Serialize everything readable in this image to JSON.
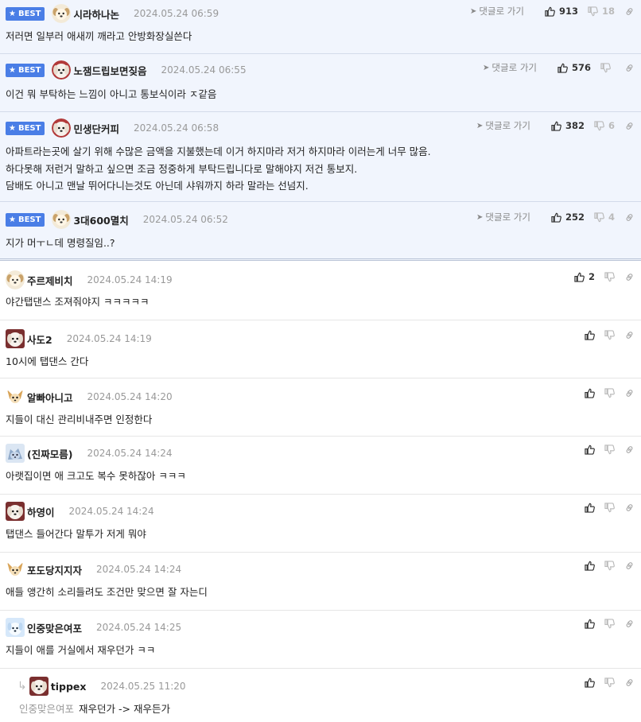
{
  "best_comments": [
    {
      "badge": "BEST",
      "nick": "시라하나논",
      "date": "2024.05.24 06:59",
      "goto": "댓글로 가기",
      "likes": "913",
      "dislikes": "18",
      "avatar": "dog-pup",
      "lines": [
        "저러면 일부러 애새끼 깨라고 안방화장실쓴다"
      ]
    },
    {
      "badge": "BEST",
      "nick": "노잼드립보면짖음",
      "date": "2024.05.24 06:55",
      "goto": "댓글로 가기",
      "likes": "576",
      "dislikes": "",
      "avatar": "dog-maltese",
      "lines": [
        "이건 뭐 부탁하는 느낌이 아니고 통보식이라 ㅈ같음"
      ]
    },
    {
      "badge": "BEST",
      "nick": "민생단커피",
      "date": "2024.05.24 06:58",
      "goto": "댓글로 가기",
      "likes": "382",
      "dislikes": "6",
      "avatar": "dog-maltese",
      "lines": [
        "아파트라는곳에 살기 위해 수많은 금액을 지불했는데 이거 하지마라 저거 하지마라 이러는게 너무 많음.",
        "하다못해 저런거 말하고 싶으면 조금 정중하게 부탁드립니다로 말해야지 저건 통보지.",
        "담배도 아니고 맨날 뛰어다니는것도 아닌데 샤워까지 하라 말라는 선넘지."
      ]
    },
    {
      "badge": "BEST",
      "nick": "3대600멸치",
      "date": "2024.05.24 06:52",
      "goto": "댓글로 가기",
      "likes": "252",
      "dislikes": "4",
      "avatar": "dog-pup",
      "lines": [
        "지가 머ㅜㄴ데 명령질임..?"
      ]
    }
  ],
  "comments": [
    {
      "nick": "주르제비치",
      "date": "2024.05.24 14:19",
      "likes": "2",
      "avatar": "dog-pup",
      "text": "야간탭댄스 조져줘야지 ㅋㅋㅋㅋㅋ"
    },
    {
      "nick": "사도2",
      "date": "2024.05.24 14:19",
      "likes": "",
      "avatar": "dog-maltese-sq",
      "text": "10시에 탭댄스 간다"
    },
    {
      "nick": "알빠아니고",
      "date": "2024.05.24 14:20",
      "likes": "",
      "avatar": "chihuahua",
      "text": "지들이 대신 관리비내주면 인정한다"
    },
    {
      "nick": "(진짜모름)",
      "date": "2024.05.24 14:24",
      "likes": "",
      "avatar": "blue-dog",
      "text": "아랫집이면 애 크고도 복수 못하잖아 ㅋㅋㅋ"
    },
    {
      "nick": "하영이",
      "date": "2024.05.24 14:24",
      "likes": "",
      "avatar": "dog-maltese-sq",
      "text": "탭댄스 들어간다 말투가 저게 뭐야"
    },
    {
      "nick": "포도당지지자",
      "date": "2024.05.24 14:24",
      "likes": "",
      "avatar": "chihuahua",
      "text": "애들 앵간히 소리들려도 조건만 맞으면 잘 자는디"
    },
    {
      "nick": "인중맞은여포",
      "date": "2024.05.24 14:25",
      "likes": "",
      "avatar": "blue-pup",
      "text": "지들이 애를 거실에서 재우던가 ㅋㅋ"
    }
  ],
  "reply": {
    "nick": "tippex",
    "date": "2024.05.25 11:20",
    "likes": "",
    "avatar": "dog-maltese-sq",
    "mention": "인중맞은여포",
    "text": "재우던가 -> 재우든가",
    "reply_icon": "reply-arrow-icon"
  },
  "colors": {
    "best_bg": "#f1f5fd",
    "badge_blue": "#4a7ee6",
    "muted": "#999999"
  }
}
